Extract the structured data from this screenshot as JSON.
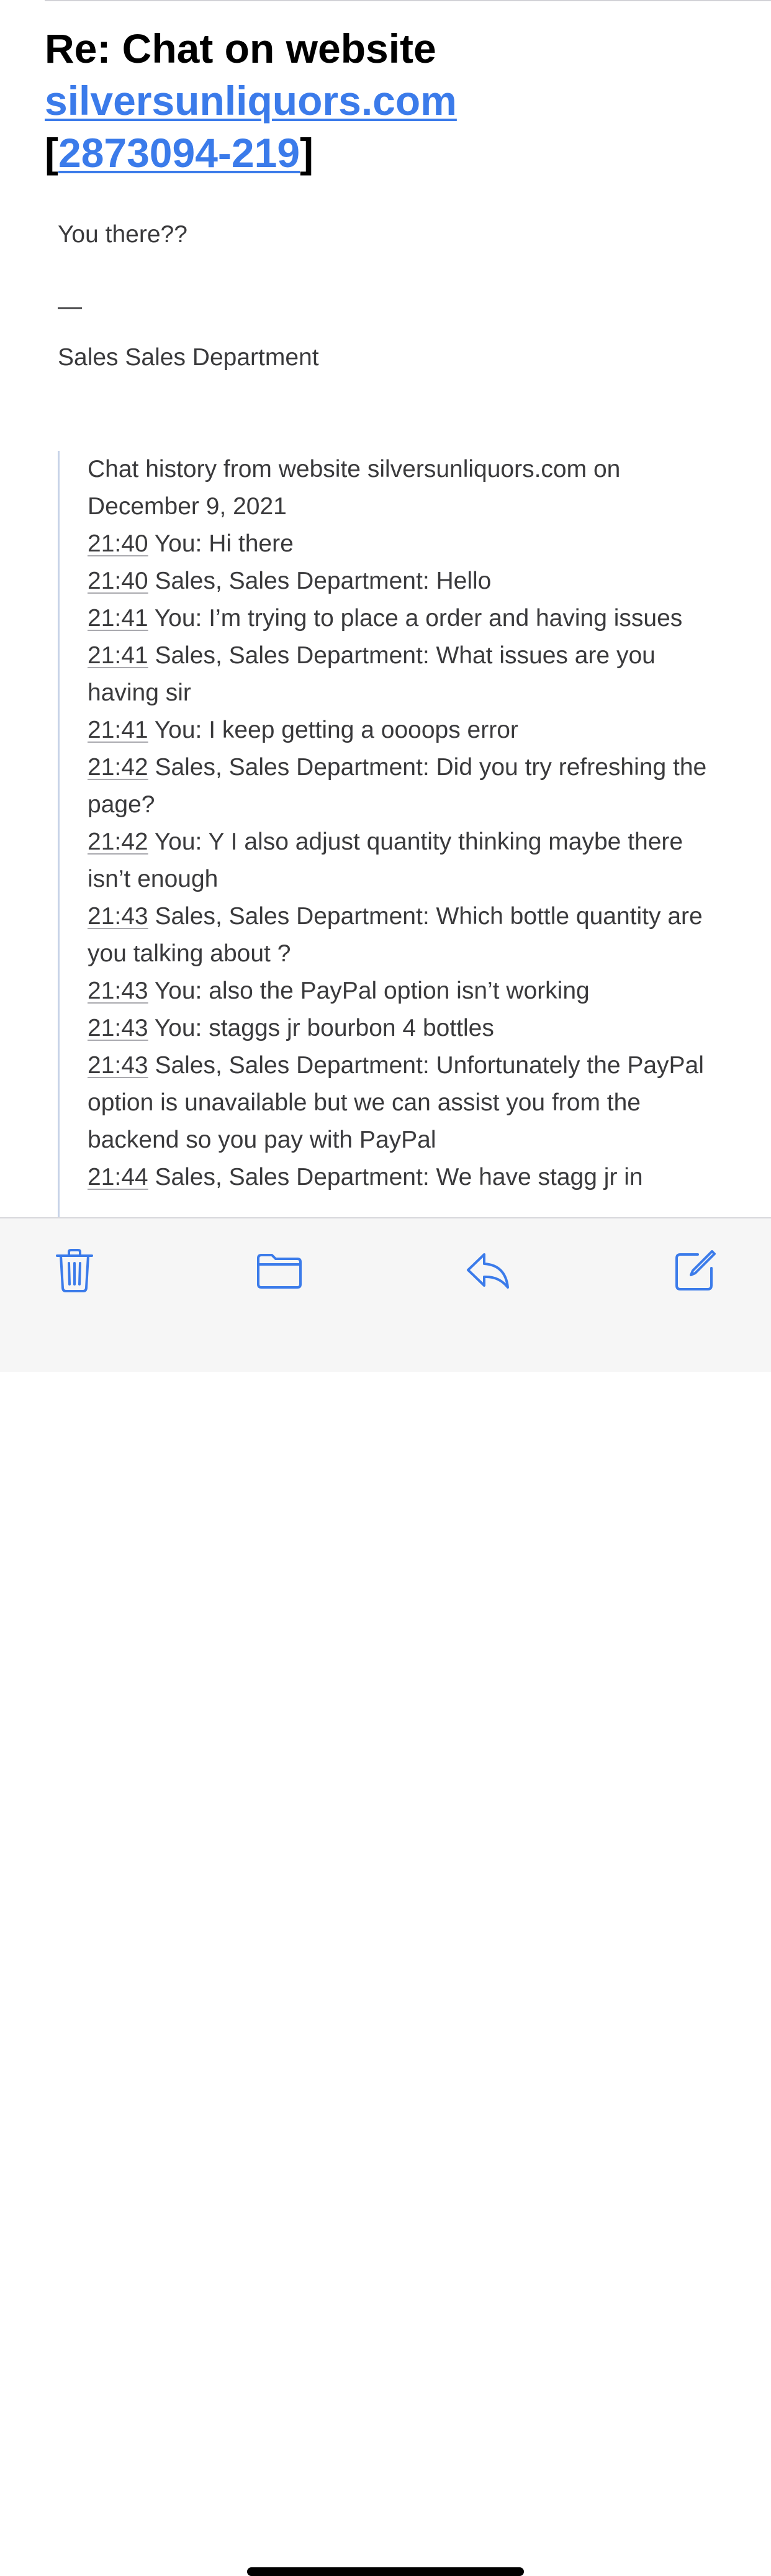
{
  "email": {
    "subject_prefix": "Re: Chat on website",
    "subject_link": "silversunliquors.com",
    "subject_bracket_open": "[",
    "subject_ticket": "2873094-219",
    "subject_bracket_close": "]",
    "greeting": "You there??",
    "signature_dash": "—",
    "signature": "Sales Sales Department"
  },
  "chat_history": {
    "header": "Chat history from website silversunliquors.com on December 9, 2021",
    "messages": [
      {
        "time": "21:40",
        "text": " You: Hi there"
      },
      {
        "time": "21:40",
        "text": " Sales, Sales Department: Hello"
      },
      {
        "time": "21:41",
        "text": " You: I’m trying to place a order and having issues"
      },
      {
        "time": "21:41",
        "text": " Sales, Sales Department: What issues are you having sir"
      },
      {
        "time": "21:41",
        "text": " You: I keep getting a oooops error"
      },
      {
        "time": "21:42",
        "text": " Sales, Sales Department: Did you try refreshing the page?"
      },
      {
        "time": "21:42",
        "text": " You: Y I also adjust quantity thinking maybe there isn’t enough"
      },
      {
        "time": "21:43",
        "text": " Sales, Sales Department: Which bottle quantity are you talking about ?"
      },
      {
        "time": "21:43",
        "text": " You: also the PayPal option isn’t working"
      },
      {
        "time": "21:43",
        "text": " You: staggs jr bourbon 4 bottles"
      },
      {
        "time": "21:43",
        "text": " Sales, Sales Department: Unfortunately the PayPal option is unavailable but we can assist you from the backend so you pay with PayPal"
      },
      {
        "time": "21:44",
        "text": " Sales, Sales Department: We have stagg jr in"
      }
    ]
  },
  "toolbar": {
    "trash_icon": "trash-icon",
    "folder_icon": "folder-icon",
    "reply_icon": "reply-icon",
    "compose_icon": "compose-icon"
  },
  "colors": {
    "link": "#3b7bea",
    "toolbar_icon": "#3b7bea",
    "quote_bar": "#c7d3e8",
    "text": "#3a3a3c"
  }
}
